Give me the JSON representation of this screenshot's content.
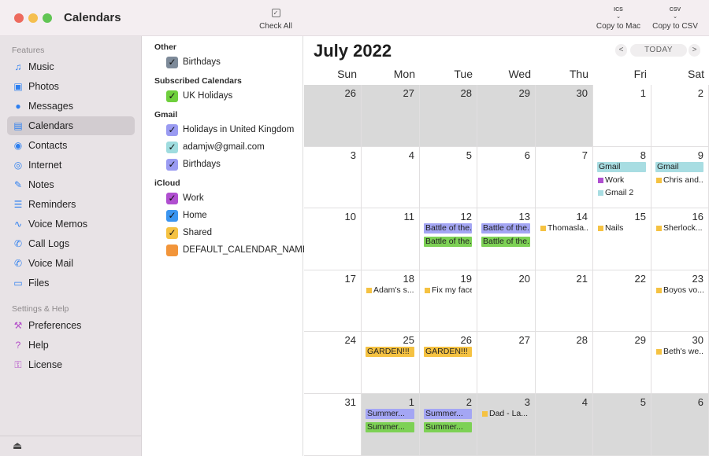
{
  "app": {
    "title": "Calendars"
  },
  "toolbar": {
    "check_all": "Check All",
    "copy_mac_icon": "ICS",
    "copy_mac": "Copy to Mac",
    "copy_csv_icon": "CSV",
    "copy_csv": "Copy to CSV"
  },
  "sidebar": {
    "features_label": "Features",
    "features": [
      {
        "label": "Music",
        "icon": "♫",
        "name": "music"
      },
      {
        "label": "Photos",
        "icon": "▣",
        "name": "photos"
      },
      {
        "label": "Messages",
        "icon": "●",
        "name": "messages"
      },
      {
        "label": "Calendars",
        "icon": "▤",
        "name": "calendars",
        "active": true
      },
      {
        "label": "Contacts",
        "icon": "◉",
        "name": "contacts"
      },
      {
        "label": "Internet",
        "icon": "◎",
        "name": "internet"
      },
      {
        "label": "Notes",
        "icon": "✎",
        "name": "notes"
      },
      {
        "label": "Reminders",
        "icon": "☰",
        "name": "reminders"
      },
      {
        "label": "Voice Memos",
        "icon": "∿",
        "name": "voice-memos"
      },
      {
        "label": "Call Logs",
        "icon": "✆",
        "name": "call-logs"
      },
      {
        "label": "Voice Mail",
        "icon": "✆",
        "name": "voice-mail"
      },
      {
        "label": "Files",
        "icon": "▭",
        "name": "files"
      }
    ],
    "settings_label": "Settings & Help",
    "settings": [
      {
        "label": "Preferences",
        "icon": "⚒",
        "name": "preferences"
      },
      {
        "label": "Help",
        "icon": "?",
        "name": "help"
      },
      {
        "label": "License",
        "icon": "⚿",
        "name": "license"
      }
    ],
    "eject_icon": "⏏"
  },
  "calendar_list": {
    "groups": [
      {
        "label": "Other",
        "items": [
          {
            "name": "Birthdays",
            "color": "#7d8a99"
          }
        ]
      },
      {
        "label": "Subscribed Calendars",
        "items": [
          {
            "name": "UK Holidays",
            "color": "#6fcf3d"
          }
        ]
      },
      {
        "label": "Gmail",
        "items": [
          {
            "name": "Holidays in United Kingdom",
            "color": "#9a9bf2"
          },
          {
            "name": "adamjw@gmail.com",
            "color": "#9fdcdf"
          },
          {
            "name": "Birthdays",
            "color": "#9a9bf2"
          }
        ]
      },
      {
        "label": "iCloud",
        "items": [
          {
            "name": "Work",
            "color": "#b04fd0"
          },
          {
            "name": "Home",
            "color": "#3b95f0"
          },
          {
            "name": "Shared",
            "color": "#f5c242"
          },
          {
            "name": "DEFAULT_CALENDAR_NAME",
            "color": "#f2953a",
            "unchecked": true
          }
        ]
      }
    ],
    "check_glyph": "✓"
  },
  "calendar": {
    "month_title": "July 2022",
    "prev": "<",
    "today": "TODAY",
    "next": ">",
    "weekdays": [
      "Sun",
      "Mon",
      "Tue",
      "Wed",
      "Thu",
      "Fri",
      "Sat"
    ],
    "weeks": [
      [
        {
          "day": "26",
          "out": true
        },
        {
          "day": "27",
          "out": true
        },
        {
          "day": "28",
          "out": true
        },
        {
          "day": "29",
          "out": true
        },
        {
          "day": "30",
          "out": true
        },
        {
          "day": "1"
        },
        {
          "day": "2"
        }
      ],
      [
        {
          "day": "3"
        },
        {
          "day": "4"
        },
        {
          "day": "5"
        },
        {
          "day": "6"
        },
        {
          "day": "7"
        },
        {
          "day": "8",
          "events": [
            {
              "text": "Gmail",
              "style": "bar",
              "color": "#a8dde2"
            },
            {
              "text": "Work",
              "style": "dot",
              "color": "#b04fd0"
            },
            {
              "text": "Gmail 2",
              "style": "dot",
              "color": "#a8dde2"
            }
          ]
        },
        {
          "day": "9",
          "events": [
            {
              "text": "Gmail",
              "style": "bar",
              "color": "#a8dde2"
            },
            {
              "text": "Chris and...",
              "style": "dot",
              "color": "#f5c242"
            }
          ]
        }
      ],
      [
        {
          "day": "10"
        },
        {
          "day": "11"
        },
        {
          "day": "12",
          "events": [
            {
              "text": "Battle of the...",
              "style": "bar",
              "color": "#a4a6f4"
            },
            {
              "text": "Battle of the...",
              "style": "bar",
              "color": "#7dd155"
            }
          ]
        },
        {
          "day": "13",
          "events": [
            {
              "text": "Battle of the...",
              "style": "bar",
              "color": "#a4a6f4"
            },
            {
              "text": "Battle of the...",
              "style": "bar",
              "color": "#7dd155"
            }
          ]
        },
        {
          "day": "14",
          "events": [
            {
              "text": "Thomasla...",
              "style": "dot",
              "color": "#f5c242"
            }
          ]
        },
        {
          "day": "15",
          "events": [
            {
              "text": "Nails",
              "style": "dot",
              "color": "#f5c242"
            }
          ]
        },
        {
          "day": "16",
          "events": [
            {
              "text": "Sherlock...",
              "style": "dot",
              "color": "#f5c242"
            }
          ]
        }
      ],
      [
        {
          "day": "17"
        },
        {
          "day": "18",
          "events": [
            {
              "text": "Adam's s...",
              "style": "dot",
              "color": "#f5c242"
            }
          ]
        },
        {
          "day": "19",
          "events": [
            {
              "text": "Fix my face",
              "style": "dot",
              "color": "#f5c242"
            }
          ]
        },
        {
          "day": "20"
        },
        {
          "day": "21"
        },
        {
          "day": "22"
        },
        {
          "day": "23",
          "events": [
            {
              "text": "Boyos vo...",
              "style": "dot",
              "color": "#f5c242"
            }
          ]
        }
      ],
      [
        {
          "day": "24"
        },
        {
          "day": "25",
          "events": [
            {
              "text": "GARDEN!!!",
              "style": "bar",
              "color": "#f5c242"
            }
          ]
        },
        {
          "day": "26",
          "events": [
            {
              "text": "GARDEN!!!",
              "style": "bar",
              "color": "#f5c242"
            }
          ]
        },
        {
          "day": "27"
        },
        {
          "day": "28"
        },
        {
          "day": "29"
        },
        {
          "day": "30",
          "events": [
            {
              "text": "Beth's we...",
              "style": "dot",
              "color": "#f5c242"
            }
          ]
        }
      ],
      [
        {
          "day": "31"
        },
        {
          "day": "1",
          "out": true,
          "events": [
            {
              "text": "Summer...",
              "style": "bar",
              "color": "#a4a6f4"
            },
            {
              "text": "Summer...",
              "style": "bar",
              "color": "#7dd155"
            }
          ]
        },
        {
          "day": "2",
          "out": true,
          "events": [
            {
              "text": "Summer...",
              "style": "bar",
              "color": "#a4a6f4"
            },
            {
              "text": "Summer...",
              "style": "bar",
              "color": "#7dd155"
            }
          ]
        },
        {
          "day": "3",
          "out": true,
          "events": [
            {
              "text": "Dad - La...",
              "style": "dot",
              "color": "#f5c242"
            }
          ]
        },
        {
          "day": "4",
          "out": true
        },
        {
          "day": "5",
          "out": true
        },
        {
          "day": "6",
          "out": true
        }
      ]
    ]
  }
}
